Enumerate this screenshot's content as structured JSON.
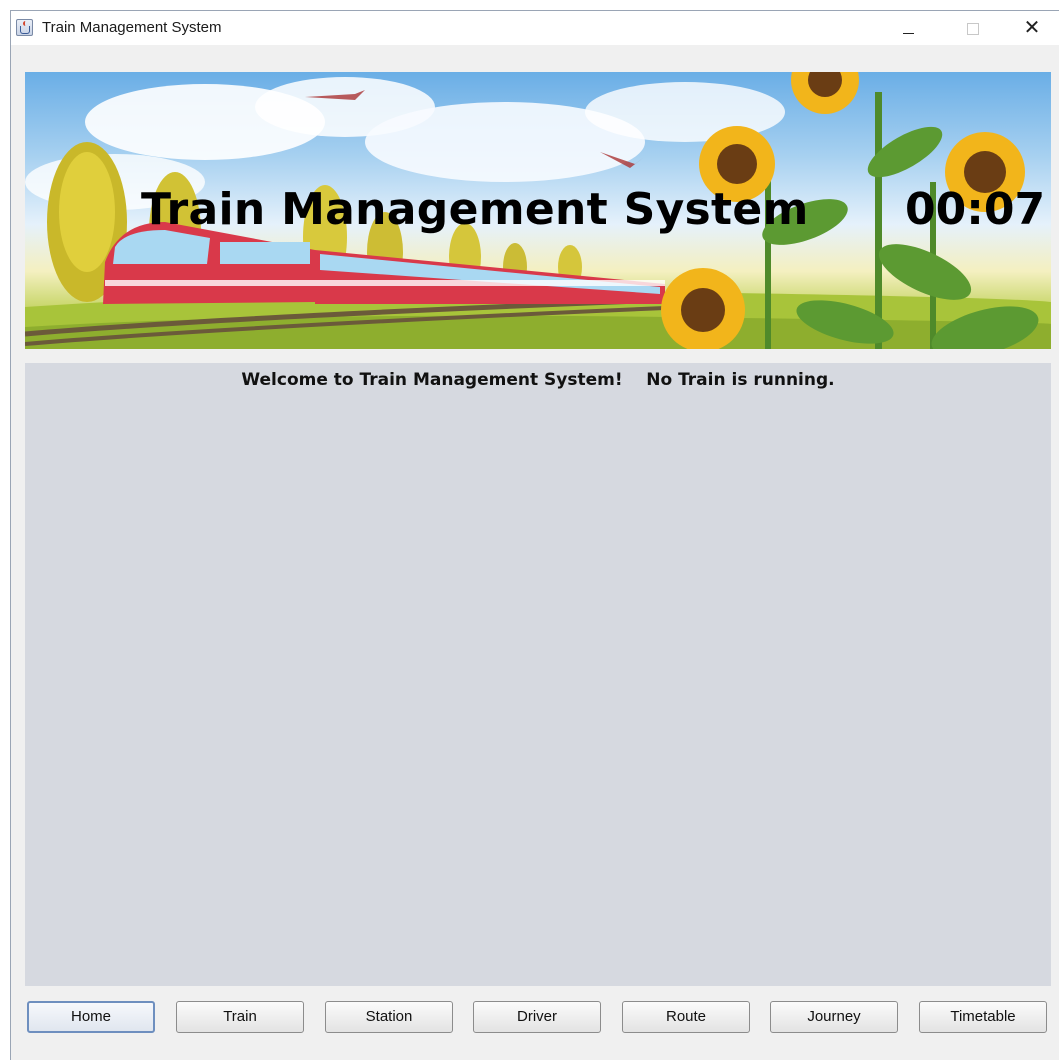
{
  "window": {
    "title": "Train Management System"
  },
  "banner": {
    "title": "Train Management System",
    "clock": "00:07"
  },
  "status": {
    "message": "Welcome to Train Management System!    No Train is running."
  },
  "nav": {
    "buttons": [
      {
        "label": "Home",
        "active": true
      },
      {
        "label": "Train"
      },
      {
        "label": "Station"
      },
      {
        "label": "Driver"
      },
      {
        "label": "Route"
      },
      {
        "label": "Journey"
      },
      {
        "label": "Timetable"
      }
    ]
  },
  "colors": {
    "content_bg": "#d6d9e0",
    "train_red": "#d9394a",
    "sunflower": "#f2b51b"
  }
}
